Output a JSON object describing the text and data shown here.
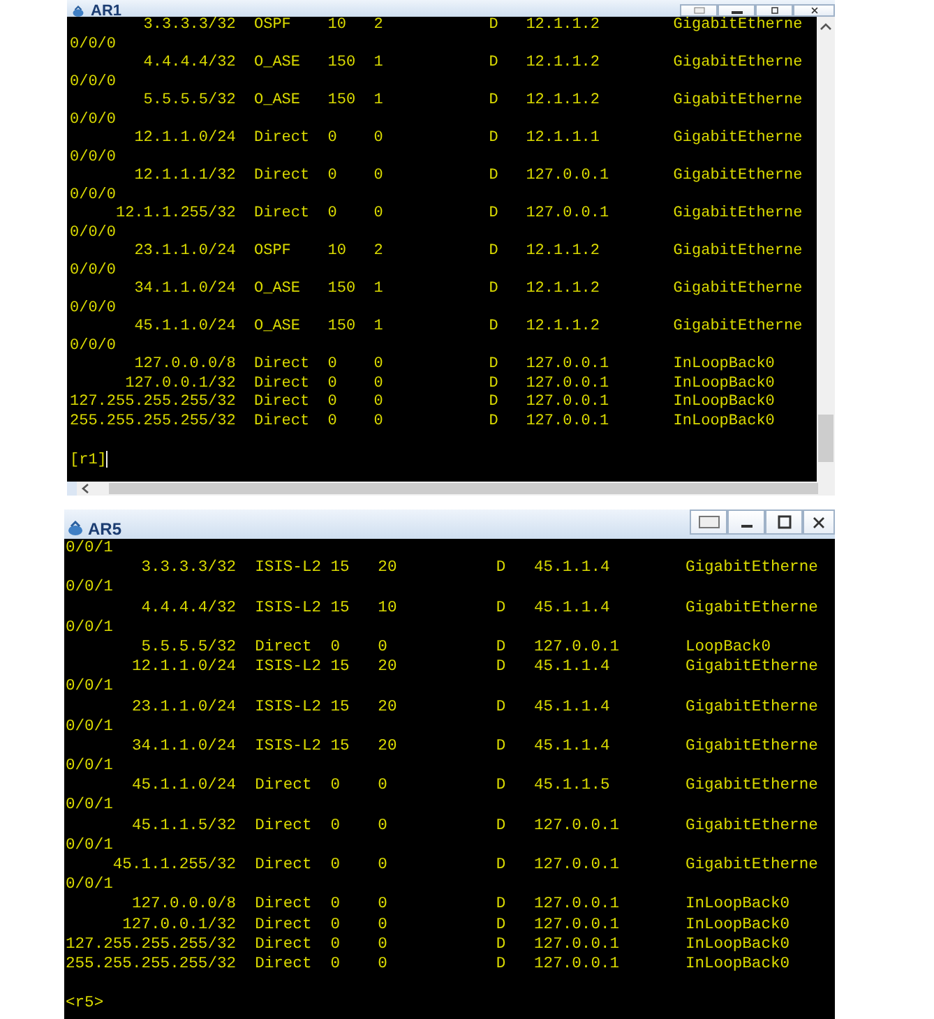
{
  "windows": [
    {
      "title": "AR1",
      "routes": [
        {
          "destination": "3.3.3.3/32",
          "proto": "OSPF",
          "pre": "10",
          "cost": "2",
          "flags": "D",
          "nexthop": "12.1.1.2",
          "interface": "GigabitEtherne",
          "wrap": "0/0/0"
        },
        {
          "destination": "4.4.4.4/32",
          "proto": "O_ASE",
          "pre": "150",
          "cost": "1",
          "flags": "D",
          "nexthop": "12.1.1.2",
          "interface": "GigabitEtherne",
          "wrap": "0/0/0"
        },
        {
          "destination": "5.5.5.5/32",
          "proto": "O_ASE",
          "pre": "150",
          "cost": "1",
          "flags": "D",
          "nexthop": "12.1.1.2",
          "interface": "GigabitEtherne",
          "wrap": "0/0/0"
        },
        {
          "destination": "12.1.1.0/24",
          "proto": "Direct",
          "pre": "0",
          "cost": "0",
          "flags": "D",
          "nexthop": "12.1.1.1",
          "interface": "GigabitEtherne",
          "wrap": "0/0/0"
        },
        {
          "destination": "12.1.1.1/32",
          "proto": "Direct",
          "pre": "0",
          "cost": "0",
          "flags": "D",
          "nexthop": "127.0.0.1",
          "interface": "GigabitEtherne",
          "wrap": "0/0/0"
        },
        {
          "destination": "12.1.1.255/32",
          "proto": "Direct",
          "pre": "0",
          "cost": "0",
          "flags": "D",
          "nexthop": "127.0.0.1",
          "interface": "GigabitEtherne",
          "wrap": "0/0/0"
        },
        {
          "destination": "23.1.1.0/24",
          "proto": "OSPF",
          "pre": "10",
          "cost": "2",
          "flags": "D",
          "nexthop": "12.1.1.2",
          "interface": "GigabitEtherne",
          "wrap": "0/0/0"
        },
        {
          "destination": "34.1.1.0/24",
          "proto": "O_ASE",
          "pre": "150",
          "cost": "1",
          "flags": "D",
          "nexthop": "12.1.1.2",
          "interface": "GigabitEtherne",
          "wrap": "0/0/0"
        },
        {
          "destination": "45.1.1.0/24",
          "proto": "O_ASE",
          "pre": "150",
          "cost": "1",
          "flags": "D",
          "nexthop": "12.1.1.2",
          "interface": "GigabitEtherne",
          "wrap": "0/0/0"
        },
        {
          "destination": "127.0.0.0/8",
          "proto": "Direct",
          "pre": "0",
          "cost": "0",
          "flags": "D",
          "nexthop": "127.0.0.1",
          "interface": "InLoopBack0"
        },
        {
          "destination": "127.0.0.1/32",
          "proto": "Direct",
          "pre": "0",
          "cost": "0",
          "flags": "D",
          "nexthop": "127.0.0.1",
          "interface": "InLoopBack0"
        },
        {
          "destination": "127.255.255.255/32",
          "proto": "Direct",
          "pre": "0",
          "cost": "0",
          "flags": "D",
          "nexthop": "127.0.0.1",
          "interface": "InLoopBack0"
        },
        {
          "destination": "255.255.255.255/32",
          "proto": "Direct",
          "pre": "0",
          "cost": "0",
          "flags": "D",
          "nexthop": "127.0.0.1",
          "interface": "InLoopBack0"
        }
      ],
      "prompt": "[r1]"
    },
    {
      "title": "AR5",
      "leading_wrap": "0/0/1",
      "routes": [
        {
          "destination": "3.3.3.3/32",
          "proto": "ISIS-L2",
          "pre": "15",
          "cost": "20",
          "flags": "D",
          "nexthop": "45.1.1.4",
          "interface": "GigabitEtherne",
          "wrap": "0/0/1"
        },
        {
          "destination": "4.4.4.4/32",
          "proto": "ISIS-L2",
          "pre": "15",
          "cost": "10",
          "flags": "D",
          "nexthop": "45.1.1.4",
          "interface": "GigabitEtherne",
          "wrap": "0/0/1"
        },
        {
          "destination": "5.5.5.5/32",
          "proto": "Direct",
          "pre": "0",
          "cost": "0",
          "flags": "D",
          "nexthop": "127.0.0.1",
          "interface": "LoopBack0"
        },
        {
          "destination": "12.1.1.0/24",
          "proto": "ISIS-L2",
          "pre": "15",
          "cost": "20",
          "flags": "D",
          "nexthop": "45.1.1.4",
          "interface": "GigabitEtherne",
          "wrap": "0/0/1"
        },
        {
          "destination": "23.1.1.0/24",
          "proto": "ISIS-L2",
          "pre": "15",
          "cost": "20",
          "flags": "D",
          "nexthop": "45.1.1.4",
          "interface": "GigabitEtherne",
          "wrap": "0/0/1"
        },
        {
          "destination": "34.1.1.0/24",
          "proto": "ISIS-L2",
          "pre": "15",
          "cost": "20",
          "flags": "D",
          "nexthop": "45.1.1.4",
          "interface": "GigabitEtherne",
          "wrap": "0/0/1"
        },
        {
          "destination": "45.1.1.0/24",
          "proto": "Direct",
          "pre": "0",
          "cost": "0",
          "flags": "D",
          "nexthop": "45.1.1.5",
          "interface": "GigabitEtherne",
          "wrap": "0/0/1"
        },
        {
          "destination": "45.1.1.5/32",
          "proto": "Direct",
          "pre": "0",
          "cost": "0",
          "flags": "D",
          "nexthop": "127.0.0.1",
          "interface": "GigabitEtherne",
          "wrap": "0/0/1"
        },
        {
          "destination": "45.1.1.255/32",
          "proto": "Direct",
          "pre": "0",
          "cost": "0",
          "flags": "D",
          "nexthop": "127.0.0.1",
          "interface": "GigabitEtherne",
          "wrap": "0/0/1"
        },
        {
          "destination": "127.0.0.0/8",
          "proto": "Direct",
          "pre": "0",
          "cost": "0",
          "flags": "D",
          "nexthop": "127.0.0.1",
          "interface": "InLoopBack0"
        },
        {
          "destination": "127.0.0.1/32",
          "proto": "Direct",
          "pre": "0",
          "cost": "0",
          "flags": "D",
          "nexthop": "127.0.0.1",
          "interface": "InLoopBack0"
        },
        {
          "destination": "127.255.255.255/32",
          "proto": "Direct",
          "pre": "0",
          "cost": "0",
          "flags": "D",
          "nexthop": "127.0.0.1",
          "interface": "InLoopBack0"
        },
        {
          "destination": "255.255.255.255/32",
          "proto": "Direct",
          "pre": "0",
          "cost": "0",
          "flags": "D",
          "nexthop": "127.0.0.1",
          "interface": "InLoopBack0"
        }
      ],
      "prompt": "<r5>"
    }
  ]
}
